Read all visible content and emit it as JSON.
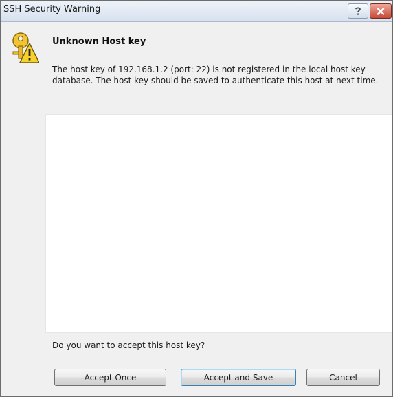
{
  "window": {
    "title": "SSH Security Warning",
    "help_icon": "help-icon",
    "close_icon": "close-icon"
  },
  "content": {
    "icon": "warning-key-icon",
    "heading": "Unknown Host key",
    "message_lines": [
      "The host key of 192.168.1.2 (port: 22) is not registered in the local host key",
      "database. The host key should be saved to authenticate this host at next time."
    ],
    "key_area_text": "",
    "question": "Do you want to accept this host key?"
  },
  "buttons": {
    "accept_once": "Accept Once",
    "accept_save": "Accept and Save",
    "cancel": "Cancel"
  },
  "colors": {
    "close_button": "#c54a38",
    "default_button_border": "#3c7fb1",
    "dialog_background": "#f0f0f0"
  }
}
